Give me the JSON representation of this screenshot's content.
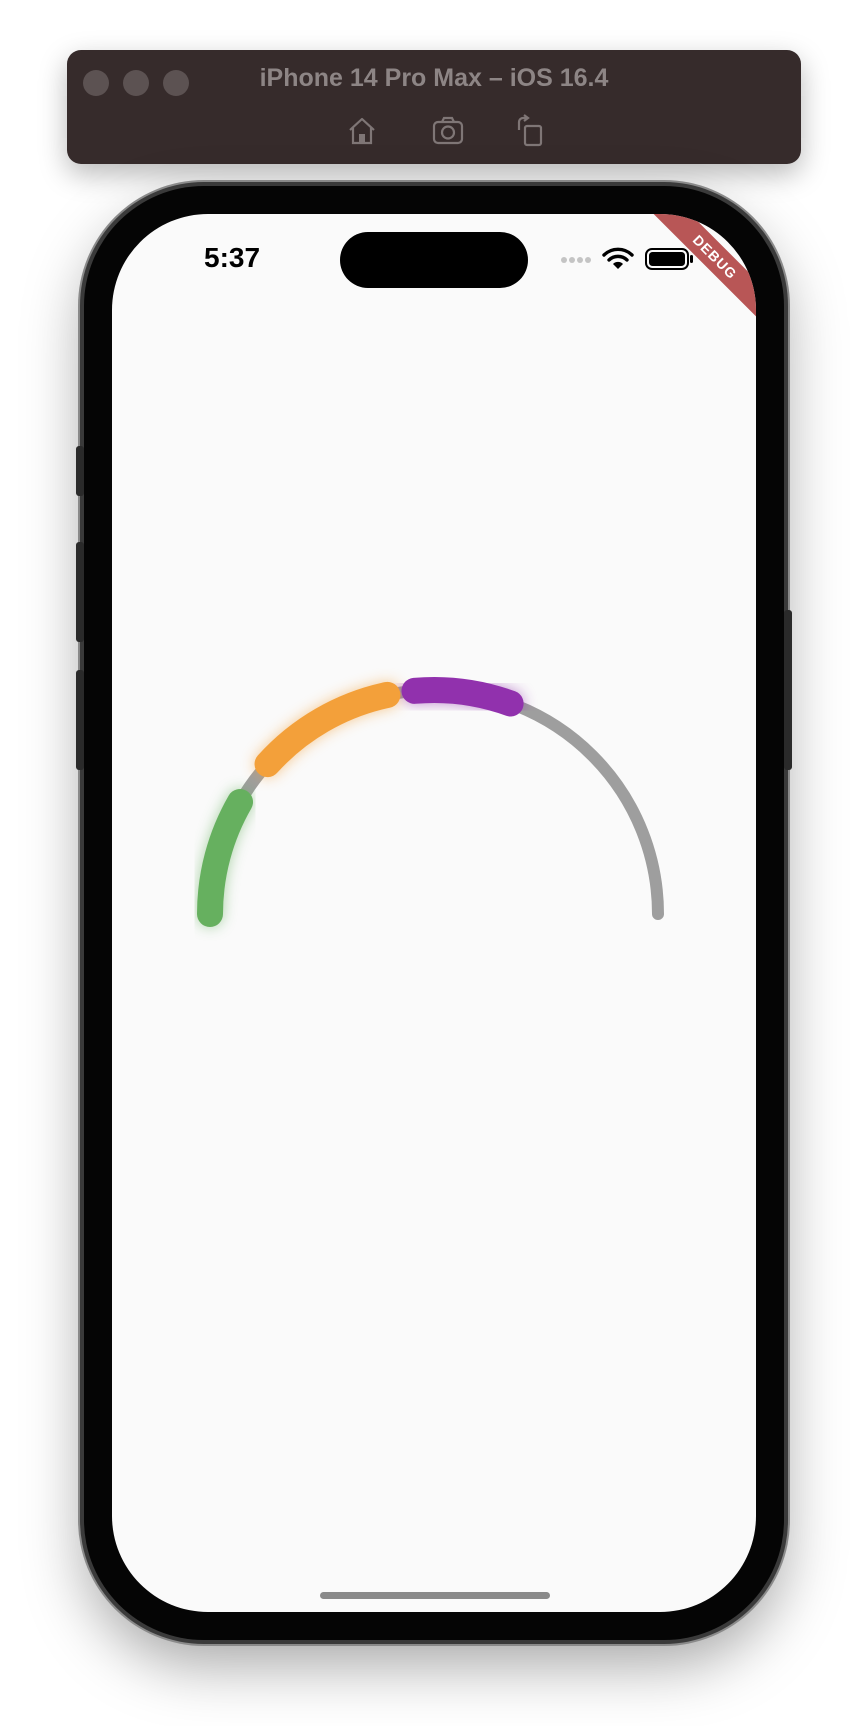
{
  "simulator": {
    "title": "iPhone 14 Pro Max – iOS 16.4",
    "toolbar": [
      {
        "name": "home-button",
        "icon": "home-icon"
      },
      {
        "name": "screenshot-button",
        "icon": "camera-icon"
      },
      {
        "name": "rotate-button",
        "icon": "rotate-icon"
      }
    ]
  },
  "status_bar": {
    "time": "5:37",
    "icons": [
      "cellular-dots-icon",
      "wifi-icon",
      "battery-icon"
    ]
  },
  "debug_banner": "DEBUG",
  "gauge": {
    "track_color": "#9e9e9e",
    "range": [
      0,
      180
    ],
    "segments": [
      {
        "start": 0,
        "end": 30,
        "color": "#66b05f"
      },
      {
        "start": 42,
        "end": 78,
        "color": "#f3a03a"
      },
      {
        "start": 85,
        "end": 110,
        "color": "#9131ad"
      }
    ]
  }
}
